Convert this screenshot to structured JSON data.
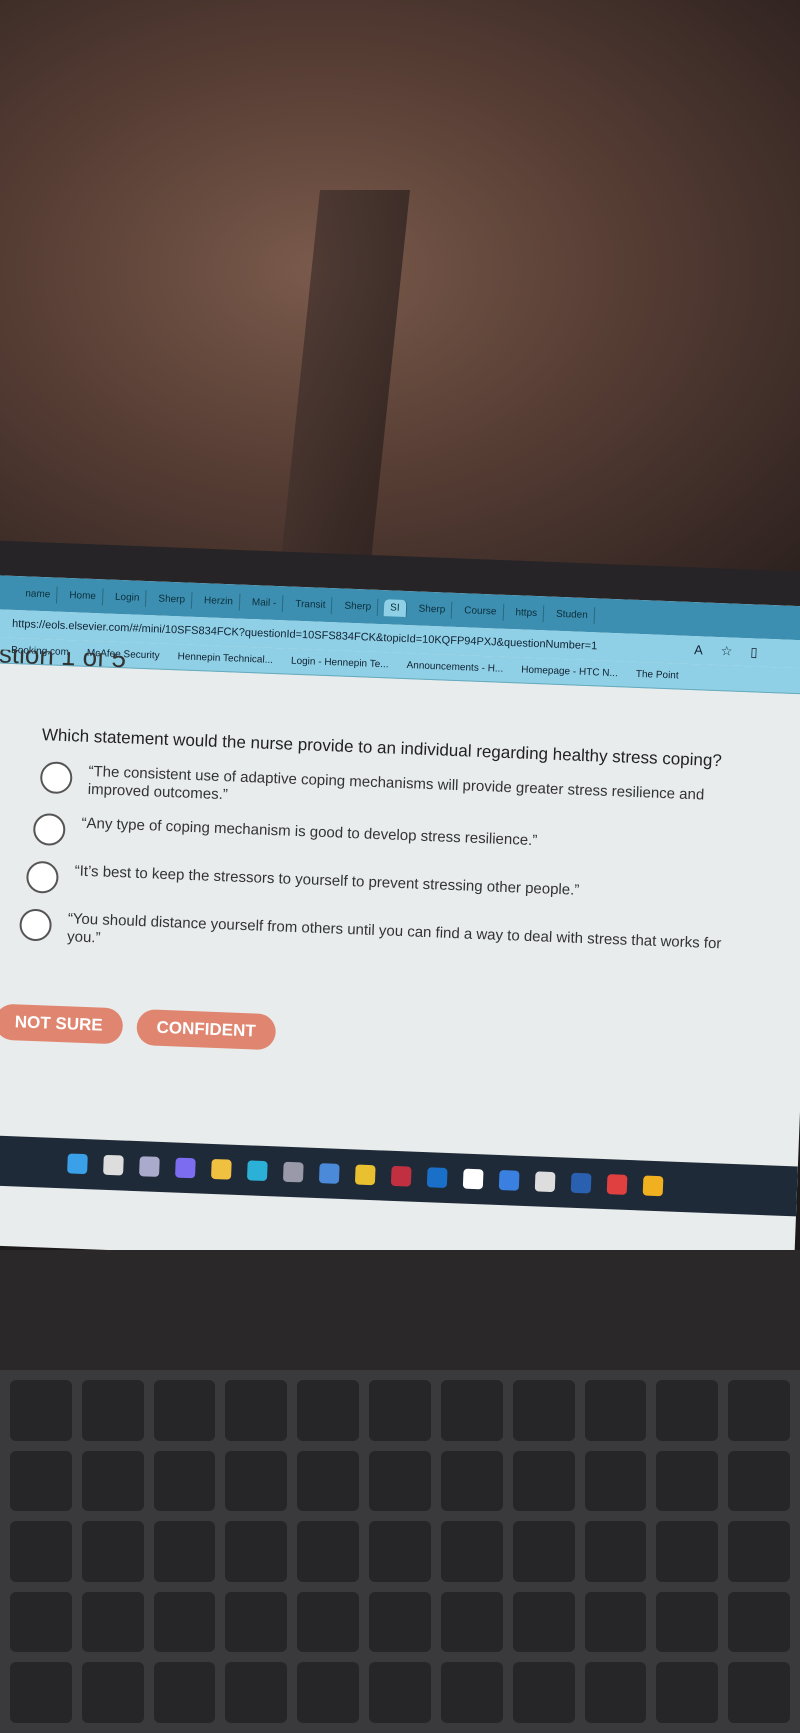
{
  "browser": {
    "tabs": [
      "name",
      "Home",
      "Login",
      "Sherp",
      "Herzin",
      "Mail -",
      "Transit",
      "Sherp",
      "SI",
      "Sherp",
      "Course",
      "https",
      "Studen"
    ],
    "active_tab_index": 8,
    "url": "https://eols.elsevier.com/#/mini/10SFS834FCK?questionId=10SFS834FCK&topicId=10KQFP94PXJ&questionNumber=1",
    "bookmarks": [
      "Booking.com",
      "McAfee Security",
      "Hennepin Technical...",
      "Login - Hennepin Te...",
      "Announcements - H...",
      "Homepage - HTC N...",
      "The Point"
    ]
  },
  "quiz": {
    "question_number": "stion 1 of 5",
    "question": "Which statement would the nurse provide to an individual regarding healthy stress coping?",
    "options": [
      "“The consistent use of adaptive coping mechanisms will provide greater stress resilience and improved outcomes.”",
      "“Any type of coping mechanism is good to develop stress resilience.”",
      "“It’s best to keep the stressors to yourself to prevent stressing other people.”",
      "“You should distance yourself from others until you can find a way to deal with stress that works for you.”"
    ],
    "not_sure_label": "NOT SURE",
    "confident_label": "CONFIDENT",
    "button_color": "#e08670"
  },
  "taskbar": {
    "icons": [
      "windows-icon",
      "search-icon",
      "task-view-icon",
      "copilot-icon",
      "file-explorer-icon",
      "edge-icon",
      "store-icon",
      "chart-app-icon",
      "chrome-icon",
      "mcafee-icon",
      "outlook-icon",
      "amazon-icon",
      "app-icon",
      "app-icon",
      "word-icon",
      "app-icon",
      "shield-icon"
    ]
  }
}
